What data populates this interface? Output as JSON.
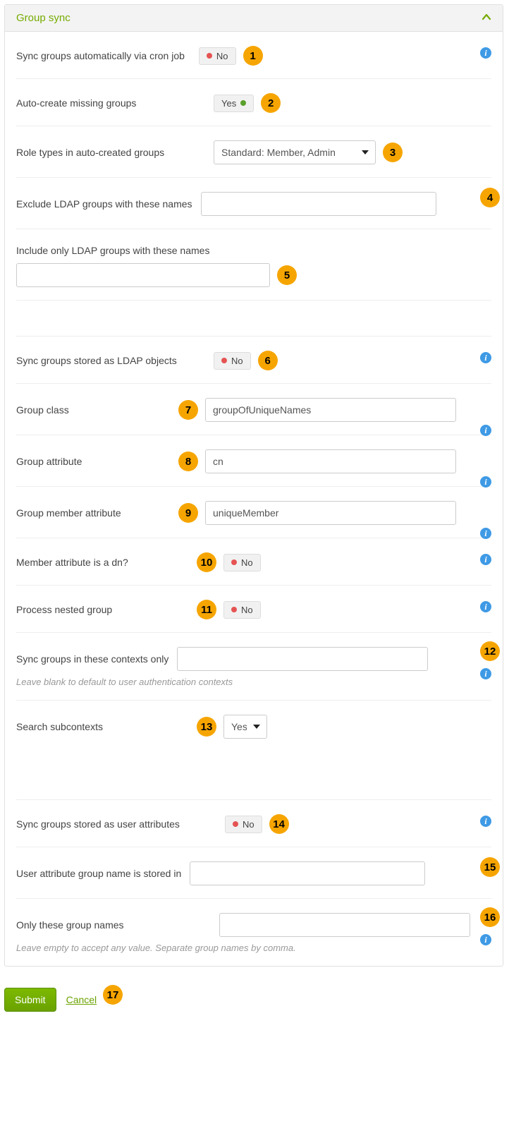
{
  "panel": {
    "title": "Group sync"
  },
  "toggle_labels": {
    "no": "No",
    "yes": "Yes"
  },
  "settings": {
    "cron": {
      "label": "Sync groups automatically via cron job",
      "value": "No"
    },
    "autocreate": {
      "label": "Auto-create missing groups",
      "value": "Yes"
    },
    "roletypes": {
      "label": "Role types in auto-created groups",
      "value": "Standard: Member, Admin"
    },
    "exclude": {
      "label": "Exclude LDAP groups with these names",
      "value": ""
    },
    "includeonly": {
      "label": "Include only LDAP groups with these names",
      "value": ""
    },
    "ldapobjects": {
      "label": "Sync groups stored as LDAP objects",
      "value": "No"
    },
    "groupclass": {
      "label": "Group class",
      "value": "groupOfUniqueNames"
    },
    "groupattr": {
      "label": "Group attribute",
      "value": "cn"
    },
    "groupmemberattr": {
      "label": "Group member attribute",
      "value": "uniqueMember"
    },
    "memberdn": {
      "label": "Member attribute is a dn?",
      "value": "No"
    },
    "nested": {
      "label": "Process nested group",
      "value": "No"
    },
    "contexts": {
      "label": "Sync groups in these contexts only",
      "value": "",
      "help": "Leave blank to default to user authentication contexts"
    },
    "subcontexts": {
      "label": "Search subcontexts",
      "value": "Yes"
    },
    "userattrs": {
      "label": "Sync groups stored as user attributes",
      "value": "No"
    },
    "userattrname": {
      "label": "User attribute group name is stored in",
      "value": ""
    },
    "onlythese": {
      "label": "Only these group names",
      "value": "",
      "help": "Leave empty to accept any value. Separate group names by comma."
    }
  },
  "footer": {
    "submit": "Submit",
    "cancel": "Cancel"
  },
  "badges": [
    "1",
    "2",
    "3",
    "4",
    "5",
    "6",
    "7",
    "8",
    "9",
    "10",
    "11",
    "12",
    "13",
    "14",
    "15",
    "16",
    "17"
  ]
}
